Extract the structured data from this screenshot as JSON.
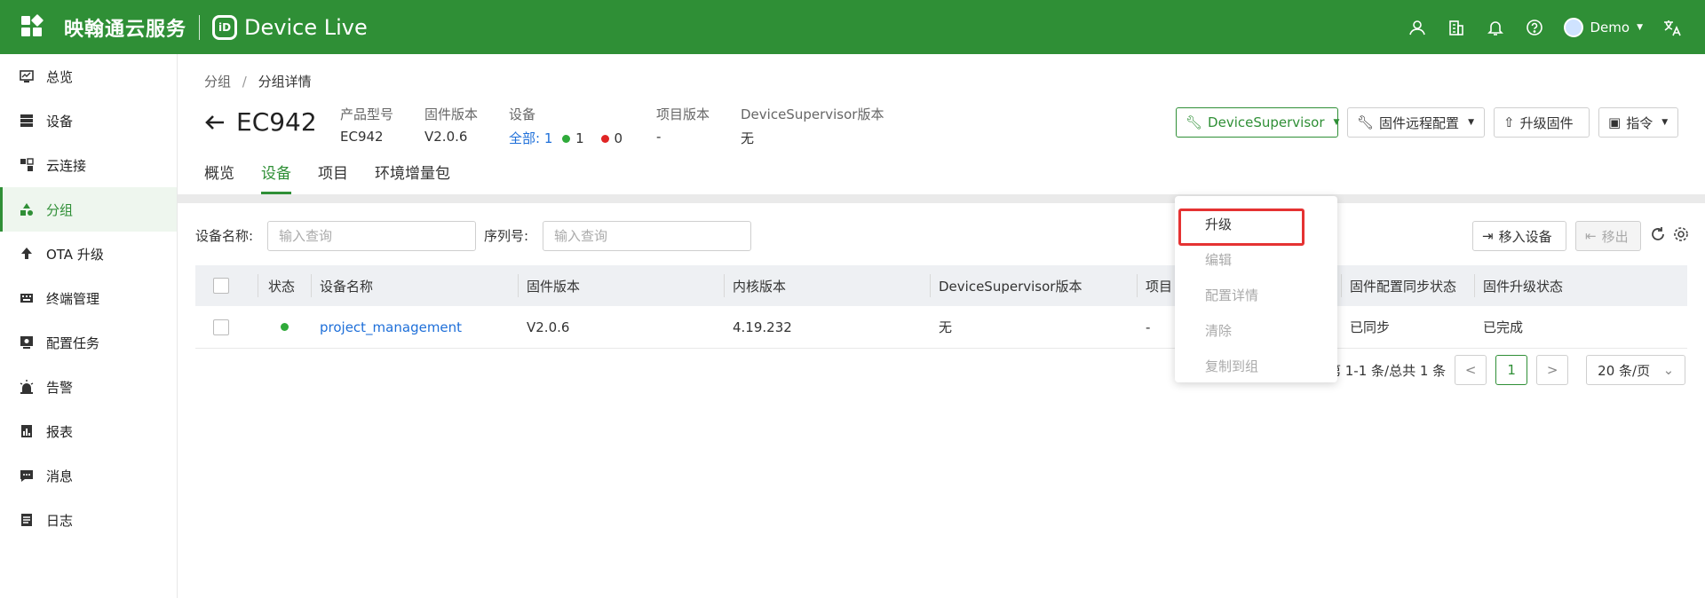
{
  "header": {
    "brand": "映翰通云服务",
    "logo_text": "iD",
    "product": "Device Live",
    "user": "Demo",
    "icons": [
      "user-group-icon",
      "building-icon",
      "bell-icon",
      "help-icon",
      "avatar",
      "translate-icon"
    ]
  },
  "sidebar": {
    "items": [
      {
        "label": "总览",
        "icon": "dashboard-icon"
      },
      {
        "label": "设备",
        "icon": "device-list-icon"
      },
      {
        "label": "云连接",
        "icon": "cloud-link-icon"
      },
      {
        "label": "分组",
        "icon": "group-icon",
        "active": true
      },
      {
        "label": "OTA 升级",
        "icon": "upload-arrow-icon"
      },
      {
        "label": "终端管理",
        "icon": "keyboard-icon"
      },
      {
        "label": "配置任务",
        "icon": "config-task-icon"
      },
      {
        "label": "告警",
        "icon": "alarm-icon"
      },
      {
        "label": "报表",
        "icon": "report-icon"
      },
      {
        "label": "消息",
        "icon": "message-icon"
      },
      {
        "label": "日志",
        "icon": "log-icon"
      }
    ]
  },
  "breadcrumb": {
    "parent": "分组",
    "sep": "/",
    "current": "分组详情"
  },
  "title": "EC942",
  "meta": {
    "model_label": "产品型号",
    "model": "EC942",
    "firmware_label": "固件版本",
    "firmware": "V2.0.6",
    "device_label": "设备",
    "device_all": "全部:",
    "device_total": "1",
    "device_online": "1",
    "device_offline": "0",
    "project_label": "项目版本",
    "project": "-",
    "ds_label": "DeviceSupervisor版本",
    "ds": "无"
  },
  "tabs": [
    "概览",
    "设备",
    "项目",
    "环境增量包"
  ],
  "toolbar": {
    "device_supervisor": "DeviceSupervisor",
    "remote_config": "固件远程配置",
    "upgrade_firmware": "升级固件",
    "command": "指令"
  },
  "dropdown": {
    "items": [
      {
        "label": "升级",
        "enabled": true
      },
      {
        "label": "编辑",
        "enabled": false
      },
      {
        "label": "配置详情",
        "enabled": false
      },
      {
        "label": "清除",
        "enabled": false
      },
      {
        "label": "复制到组",
        "enabled": false
      }
    ]
  },
  "filters": {
    "name_label": "设备名称:",
    "name_placeholder": "输入查询",
    "serial_label": "序列号:",
    "serial_placeholder": "输入查询",
    "move_in": "移入设备",
    "move_out": "移出"
  },
  "table": {
    "columns": [
      "状态",
      "设备名称",
      "固件版本",
      "内核版本",
      "DeviceSupervisor版本",
      "项目",
      "固件配置同步状态",
      "固件升级状态"
    ],
    "rows": [
      {
        "status": "online",
        "name": "project_management",
        "firmware": "V2.0.6",
        "kernel": "4.19.232",
        "ds": "无",
        "project": "-",
        "sync": "已同步",
        "upgrade": "已完成"
      }
    ]
  },
  "pagination": {
    "summary": "第 1-1 条/总共 1 条",
    "current": "1",
    "page_size": "20 条/页"
  },
  "colors": {
    "primary": "#2f8f36",
    "link": "#1e6fd9",
    "online": "#2faa3a",
    "offline": "#e02424",
    "highlight": "#e53232"
  }
}
